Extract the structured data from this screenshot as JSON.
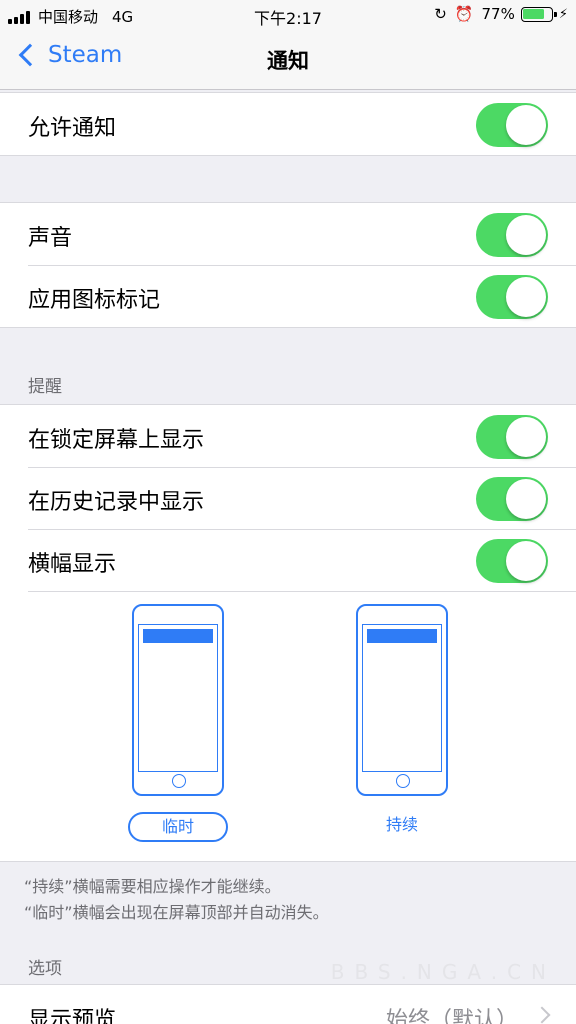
{
  "status_bar": {
    "carrier": "中国移动",
    "network": "4G",
    "time": "下午2:17",
    "battery_percent": "77%",
    "battery_level": 0.77,
    "icons": [
      "signal-icon",
      "orientation-lock-icon",
      "alarm-icon",
      "battery-icon",
      "charging-bolt-icon"
    ]
  },
  "nav": {
    "back_label": "Steam",
    "title": "通知"
  },
  "allow": {
    "label": "允许通知",
    "on": true
  },
  "sound_group": [
    {
      "label": "声音",
      "on": true
    },
    {
      "label": "应用图标标记",
      "on": true
    }
  ],
  "alerts": {
    "header": "提醒",
    "rows": [
      {
        "label": "在锁定屏幕上显示",
        "on": true
      },
      {
        "label": "在历史记录中显示",
        "on": true
      },
      {
        "label": "横幅显示",
        "on": true
      }
    ],
    "banner_styles": [
      "临时",
      "持续"
    ],
    "selected_style": "临时",
    "footnote_lines": [
      "“持续”横幅需要相应操作才能继续。",
      "“临时”横幅会出现在屏幕顶部并自动消失。"
    ]
  },
  "options": {
    "header": "选项",
    "preview_label": "显示预览",
    "preview_value": "始终（默认）"
  },
  "watermark": "BBS.NGA.CN",
  "colors": {
    "accent": "#2f7cf6",
    "toggle_on": "#4cd964",
    "background": "#efeff4",
    "secondary_text": "#6d6d72"
  }
}
